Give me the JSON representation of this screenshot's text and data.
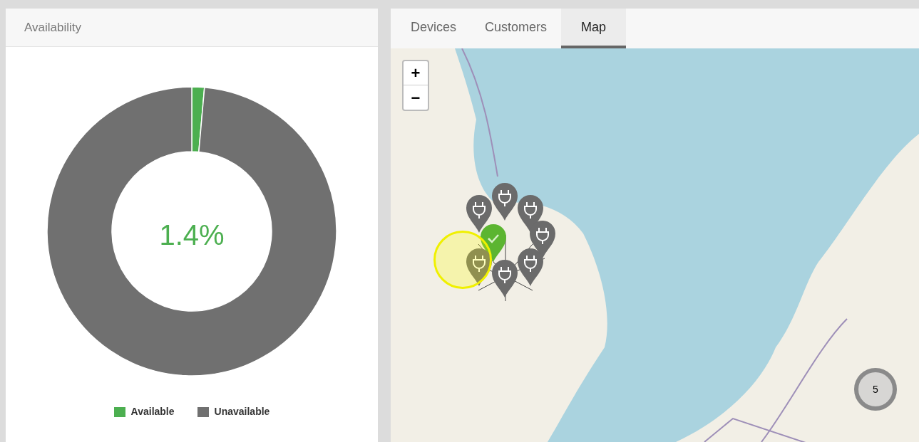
{
  "availability_panel": {
    "title": "Availability",
    "chart_data": {
      "type": "donut",
      "categories": [
        "Available",
        "Unavailable"
      ],
      "values": [
        1.4,
        98.6
      ]
    },
    "center_label": "1.4%"
  },
  "tabs": [
    {
      "label": "Devices",
      "selected": false
    },
    {
      "label": "Customers",
      "selected": false
    },
    {
      "label": "Map",
      "selected": true
    }
  ],
  "map": {
    "zoom_in": "+",
    "zoom_out": "−",
    "markers": [
      {
        "kind": "available"
      },
      {
        "kind": "charger"
      },
      {
        "kind": "charger"
      },
      {
        "kind": "charger"
      },
      {
        "kind": "charger"
      },
      {
        "kind": "charger"
      },
      {
        "kind": "charger"
      },
      {
        "kind": "charger"
      }
    ],
    "cluster": {
      "count": "5"
    }
  }
}
